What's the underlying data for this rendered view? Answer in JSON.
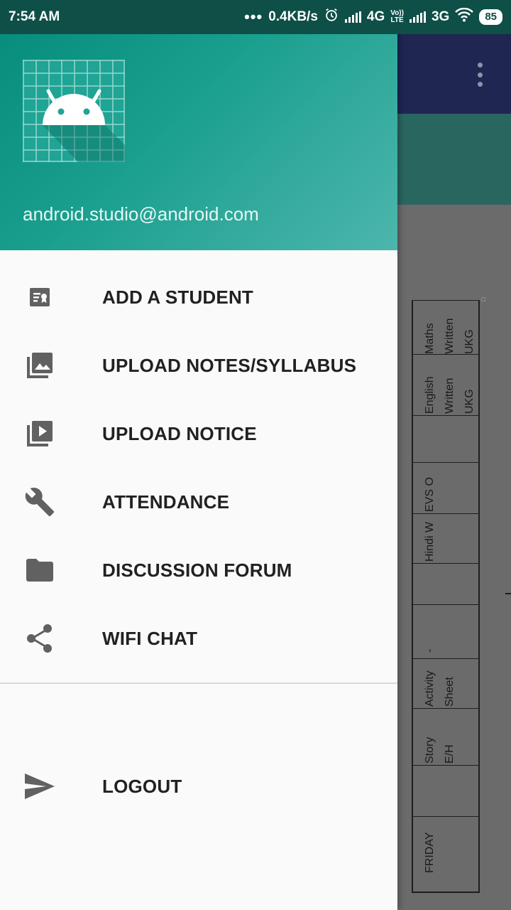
{
  "status_bar": {
    "time": "7:54 AM",
    "more_indicator": "•••",
    "net_speed": "0.4KB/s",
    "network_1": "4G",
    "volte_top": "Vo))",
    "volte_bottom": "LTE",
    "network_2": "3G",
    "battery": "85",
    "icons": [
      "alarm-icon",
      "signal-icon",
      "wifi-icon",
      "battery-icon"
    ]
  },
  "drawer": {
    "header": {
      "email": "android.studio@android.com",
      "logo_icon": "android-robot-icon",
      "gradient_colors": [
        "#058b7a",
        "#4db6ac"
      ]
    },
    "items": [
      {
        "label": "ADD A STUDENT",
        "icon": "add-student-icon"
      },
      {
        "label": "UPLOAD NOTES/SYLLABUS",
        "icon": "photo-library-icon"
      },
      {
        "label": "UPLOAD NOTICE",
        "icon": "video-library-icon"
      },
      {
        "label": "ATTENDANCE",
        "icon": "wrench-icon"
      },
      {
        "label": "DISCUSSION FORUM",
        "icon": "folder-icon"
      },
      {
        "label": "WIFI CHAT",
        "icon": "share-icon"
      }
    ],
    "footer_items": [
      {
        "label": "LOGOUT",
        "icon": "send-icon"
      }
    ]
  },
  "background": {
    "toolbar_color": "#1f2652",
    "band_color": "#2a6660",
    "timetable_cells": [
      "Maths\nWritten\nUKG",
      "English\nWritten UKG",
      "EVS O",
      "Hindi W",
      "-",
      "Activity\nSheet",
      "Story E/H",
      "FRIDAY"
    ]
  },
  "colors": {
    "accent": "#009688",
    "status_bar": "#0e4f47",
    "menu_text": "#212121",
    "icon_gray": "#616161"
  }
}
